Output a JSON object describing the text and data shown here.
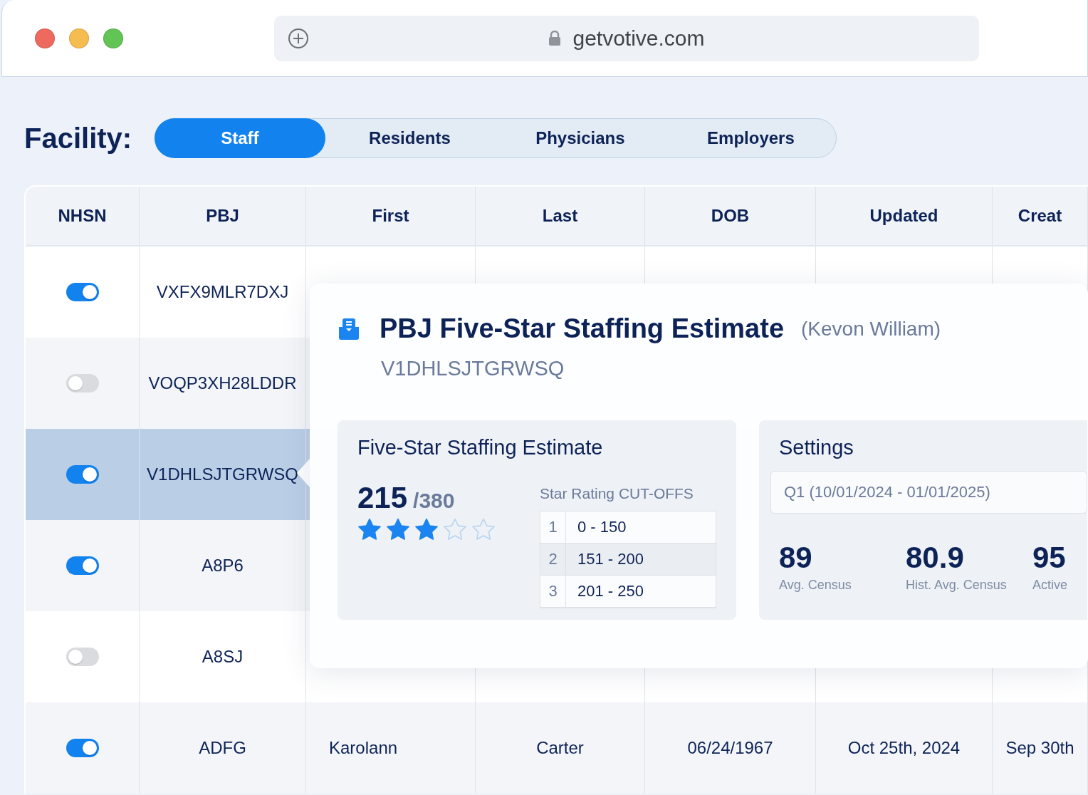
{
  "browser": {
    "url": "getvotive.com"
  },
  "facility": {
    "label": "Facility:",
    "tabs": [
      {
        "label": "Staff",
        "selected": true
      },
      {
        "label": "Residents",
        "selected": false
      },
      {
        "label": "Physicians",
        "selected": false
      },
      {
        "label": "Employers",
        "selected": false
      }
    ]
  },
  "table": {
    "columns": [
      "NHSN",
      "PBJ",
      "First",
      "Last",
      "DOB",
      "Updated",
      "Creat"
    ],
    "rows": [
      {
        "nhsn_on": true,
        "pbj": "VXFX9MLR7DXJ",
        "selected": false
      },
      {
        "nhsn_on": false,
        "pbj": "VOQP3XH28LDDR",
        "selected": false
      },
      {
        "nhsn_on": true,
        "pbj": "V1DHLSJTGRWSQ",
        "selected": true
      },
      {
        "nhsn_on": true,
        "pbj": "A8P6",
        "selected": false
      },
      {
        "nhsn_on": false,
        "pbj": "A8SJ",
        "selected": false
      },
      {
        "nhsn_on": true,
        "pbj": "ADFG",
        "first": "Karolann",
        "last": "Carter",
        "dob": "06/24/1967",
        "updated": "Oct 25th, 2024",
        "created": "Sep 30th",
        "selected": false
      }
    ]
  },
  "popover": {
    "title": "PBJ Five-Star Staffing Estimate",
    "person": "(Kevon William)",
    "pbj": "V1DHLSJTGRWSQ",
    "estimate": {
      "title": "Five-Star Staffing Estimate",
      "score": "215",
      "max": "/380",
      "stars": 3,
      "cutoffs_title": "Star Rating CUT-OFFS",
      "cutoffs": [
        {
          "rank": "1",
          "range": "0 - 150"
        },
        {
          "rank": "2",
          "range": "151 - 200"
        },
        {
          "rank": "3",
          "range": "201 - 250"
        }
      ]
    },
    "settings": {
      "title": "Settings",
      "period": "Q1 (10/01/2024 - 01/01/2025)",
      "stats": [
        {
          "value": "89",
          "label": "Avg. Census"
        },
        {
          "value": "80.9",
          "label": "Hist. Avg. Census"
        },
        {
          "value": "95",
          "label": "Active"
        }
      ]
    }
  }
}
